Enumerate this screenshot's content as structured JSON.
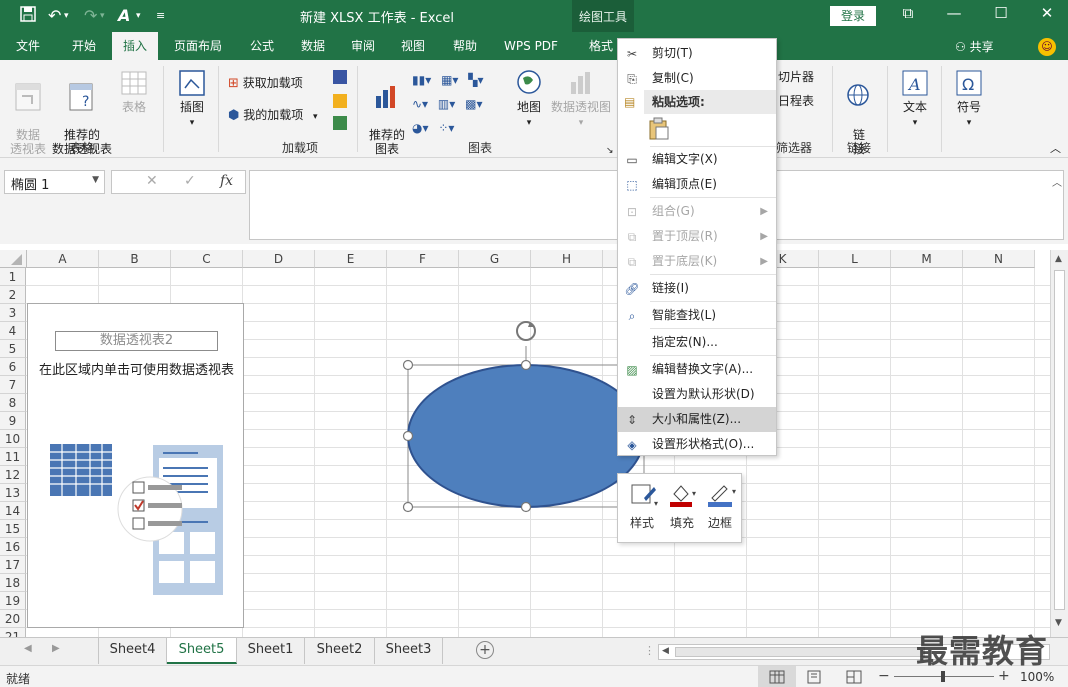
{
  "titlebar": {
    "title": "新建 XLSX 工作表 - Excel",
    "context_tab": "绘图工具",
    "login_label": "登录"
  },
  "tabs": [
    "文件",
    "开始",
    "插入",
    "页面布局",
    "公式",
    "数据",
    "审阅",
    "视图",
    "帮助",
    "WPS PDF",
    "格式"
  ],
  "active_tab": "插入",
  "share_label": "共享",
  "ribbon": {
    "tables": {
      "pivot": "数据\n透视表",
      "recommended_pivot": "推荐的\n数据透视表",
      "table": "表格",
      "group_label": "表格"
    },
    "illustrations": {
      "label": "插图"
    },
    "addins": {
      "get": "获取加载项",
      "mine": "我的加载项",
      "group_label": "加载项"
    },
    "charts": {
      "recommended": "推荐的\n图表",
      "map": "地图",
      "pivot_chart": "数据透视图",
      "group_label": "图表"
    },
    "filters": {
      "slicer": "切片器",
      "timeline": "日程表",
      "group_label": "筛选器"
    },
    "links": {
      "link": "链\n接",
      "group_label": "链接"
    },
    "text": {
      "label": "文本"
    },
    "symbols": {
      "label": "符号"
    }
  },
  "namebox": "椭圆 1",
  "columns": [
    "A",
    "B",
    "C",
    "D",
    "E",
    "F",
    "G",
    "H",
    "I",
    "J",
    "K",
    "L",
    "M",
    "N"
  ],
  "rows": [
    "1",
    "2",
    "3",
    "4",
    "5",
    "6",
    "7",
    "8",
    "9",
    "10",
    "11",
    "12",
    "13",
    "14",
    "15",
    "16",
    "17",
    "18",
    "19",
    "20",
    "21"
  ],
  "pivot_placeholder": {
    "title": "数据透视表2",
    "hint": "在此区域内单击可使用数据透视表"
  },
  "context_menu": {
    "items": [
      {
        "label": "剪切(T)",
        "icon": "scissors-icon",
        "disabled": false
      },
      {
        "label": "复制(C)",
        "icon": "copy-icon",
        "disabled": false
      },
      {
        "label": "粘贴选项:",
        "icon": "paste-icon",
        "header": true
      },
      {
        "label": "编辑文字(X)",
        "icon": "edit-text-icon",
        "disabled": false
      },
      {
        "label": "编辑顶点(E)",
        "icon": "edit-points-icon",
        "disabled": false
      },
      {
        "label": "组合(G)",
        "icon": "group-icon",
        "disabled": true,
        "submenu": true
      },
      {
        "label": "置于顶层(R)",
        "icon": "bring-front-icon",
        "disabled": true,
        "submenu": true
      },
      {
        "label": "置于底层(K)",
        "icon": "send-back-icon",
        "disabled": true,
        "submenu": true
      },
      {
        "label": "链接(I)",
        "icon": "link-icon",
        "disabled": false
      },
      {
        "label": "智能查找(L)",
        "icon": "smart-lookup-icon",
        "disabled": false
      },
      {
        "label": "指定宏(N)...",
        "icon": "",
        "disabled": false
      },
      {
        "label": "编辑替换文字(A)...",
        "icon": "alt-text-icon",
        "disabled": false
      },
      {
        "label": "设置为默认形状(D)",
        "icon": "",
        "disabled": false
      },
      {
        "label": "大小和属性(Z)...",
        "icon": "size-properties-icon",
        "disabled": false,
        "highlighted": true
      },
      {
        "label": "设置形状格式(O)...",
        "icon": "format-shape-icon",
        "disabled": false
      }
    ]
  },
  "mini_toolbar": {
    "style": "样式",
    "fill": "填充",
    "outline": "边框"
  },
  "sheet_tabs": [
    "Sheet4",
    "Sheet5",
    "Sheet1",
    "Sheet2",
    "Sheet3"
  ],
  "active_sheet": "Sheet5",
  "status": {
    "ready": "就绪",
    "zoom": "100%"
  },
  "watermark": "最需教育",
  "colors": {
    "excel_green": "#217346",
    "ellipse_fill": "#4472c4",
    "ellipse_stroke": "#2f528f"
  }
}
